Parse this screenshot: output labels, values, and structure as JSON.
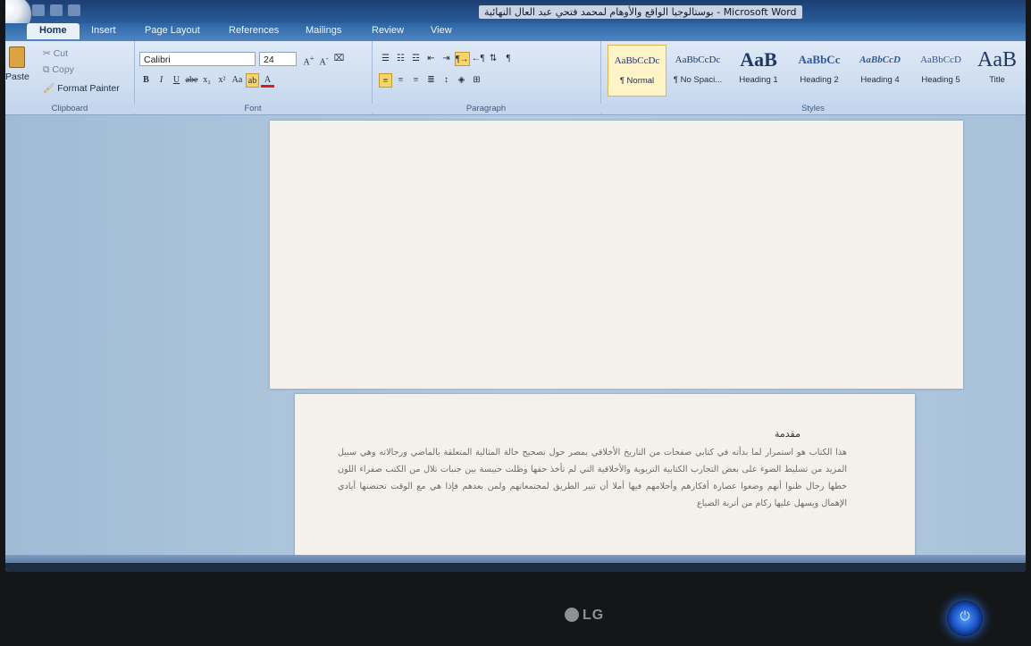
{
  "window": {
    "title": "Microsoft Word - بوستالوجيا الواقع والأوهام لمحمد فتحي عبد العال النهائية"
  },
  "tabs": [
    "Home",
    "Insert",
    "Page Layout",
    "References",
    "Mailings",
    "Review",
    "View"
  ],
  "clipboard": {
    "paste": "Paste",
    "cut": "Cut",
    "copy": "Copy",
    "format_painter": "Format Painter",
    "label": "Clipboard"
  },
  "font": {
    "name": "Calibri",
    "size": "24",
    "label": "Font"
  },
  "paragraph": {
    "label": "Paragraph"
  },
  "styles": {
    "label": "Styles",
    "items": [
      {
        "sample": "AaBbCcDc",
        "name": "¶ Normal"
      },
      {
        "sample": "AaBbCcDc",
        "name": "¶ No Spaci..."
      },
      {
        "sample": "AaB",
        "name": "Heading 1"
      },
      {
        "sample": "AaBbCc",
        "name": "Heading 2"
      },
      {
        "sample": "AaBbCcD",
        "name": "Heading 4"
      },
      {
        "sample": "AaBbCcD",
        "name": "Heading 5"
      },
      {
        "sample": "AaB",
        "name": "Title"
      }
    ]
  },
  "document": {
    "heading": "مقدمة",
    "paragraph": "هذا الكتاب هو استمرار لما بدأته في كتابي صفحات من التاريخ الأخلاقي بمصر حول تصحيح حالة المثالية المتعلقة بالماضي ورجالاته وهي سبيل المزيد من تسليط الضوء على بعض التجارب الكتابية التربوية والأخلاقية التي لم تأخذ حقها وظلت حبيسة بين جنبات تلال من الكتب صفراء اللون خطها رجال ظنوا أنهم وضعوا عصارة أفكارهم وأحلامهم فيها أملا أن تنير الطريق لمجتمعاتهم ولمن بعدهم فإذا هي مع الوقت تحتضنها أيادي الإهمال ويسهل عليها ركام من أتربة الضياع"
  },
  "monitor": {
    "brand": "LG"
  }
}
